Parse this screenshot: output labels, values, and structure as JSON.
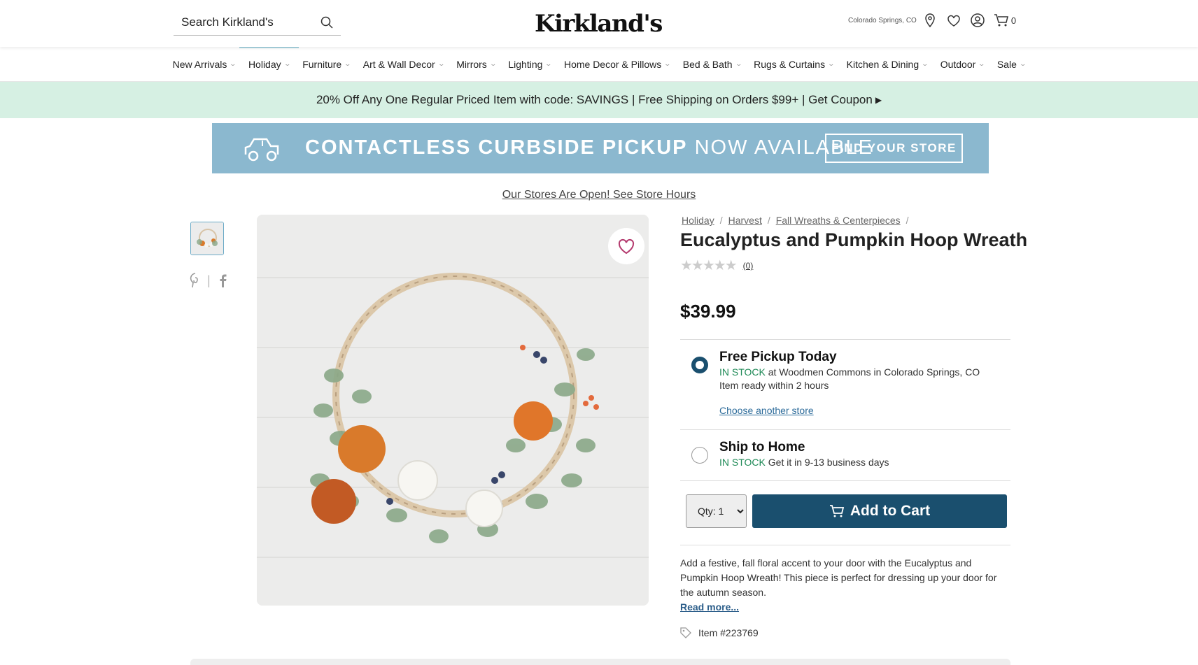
{
  "header": {
    "search_placeholder": "Search Kirkland's",
    "logo": "Kirkland's",
    "location": "Colorado Springs, CO",
    "cart_count": "0"
  },
  "nav": {
    "items": [
      {
        "label": "New Arrivals"
      },
      {
        "label": "Holiday"
      },
      {
        "label": "Furniture"
      },
      {
        "label": "Art & Wall Decor"
      },
      {
        "label": "Mirrors"
      },
      {
        "label": "Lighting"
      },
      {
        "label": "Home Decor & Pillows"
      },
      {
        "label": "Bed & Bath"
      },
      {
        "label": "Rugs & Curtains"
      },
      {
        "label": "Kitchen & Dining"
      },
      {
        "label": "Outdoor"
      },
      {
        "label": "Sale"
      }
    ]
  },
  "promo": {
    "text": "20% Off Any One Regular Priced Item with code: SAVINGS | Free Shipping on Orders $99+ | Get Coupon"
  },
  "banner": {
    "headline_bold": "CONTACTLESS CURBSIDE PICKUP",
    "headline_light": "NOW AVAILABLE",
    "button": "FIND YOUR STORE"
  },
  "store_hours_link": "Our Stores Are Open! See Store Hours",
  "product": {
    "breadcrumbs": [
      "Holiday",
      "Harvest",
      "Fall Wreaths & Centerpieces"
    ],
    "title": "Eucalyptus and Pumpkin Hoop Wreath",
    "rating_count": "(0)",
    "price": "$39.99",
    "pickup": {
      "title": "Free Pickup Today",
      "stock": "IN STOCK",
      "location_text": "at Woodmen Commons in Colorado Springs, CO",
      "ready_text": "Item ready within 2 hours",
      "choose_store": "Choose another store"
    },
    "ship": {
      "title": "Ship to Home",
      "stock": "IN STOCK",
      "eta": "Get it in 9-13 business days"
    },
    "qty_label": "Qty: 1",
    "add_to_cart": "Add to Cart",
    "description": "Add a festive, fall floral accent to your door with the Eucalyptus and Pumpkin Hoop Wreath! This piece is perfect for dressing up your door for the autumn season.",
    "read_more": "Read more...",
    "item_number": "Item #223769"
  },
  "colors": {
    "accent": "#1a4f6e",
    "promo_bg": "#d6f0e3",
    "in_stock": "#1f8a57",
    "banner_bg": "#8bb8cf"
  }
}
